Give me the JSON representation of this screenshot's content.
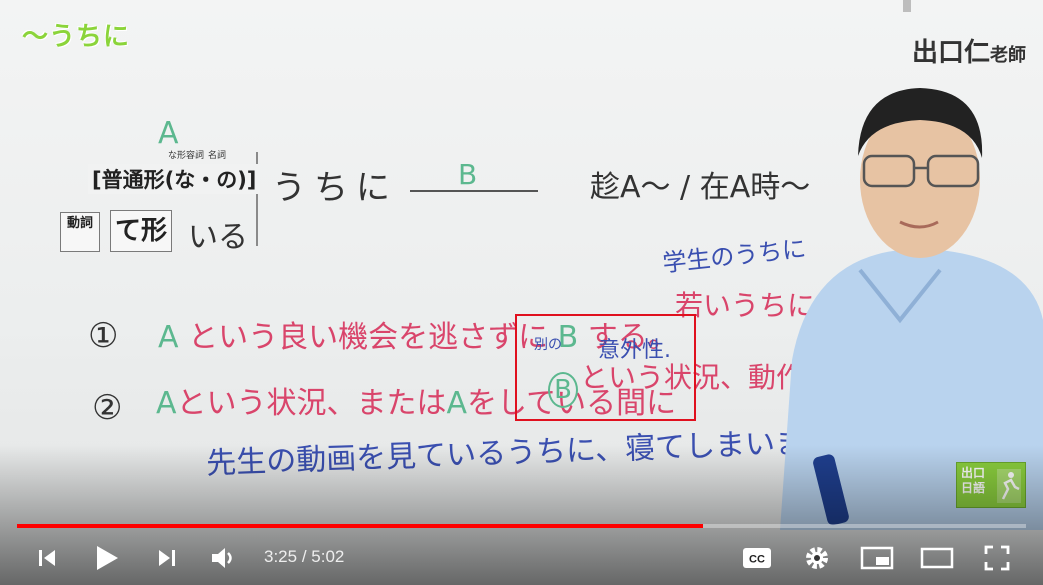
{
  "video": {
    "title": "〜うちに",
    "teacher_name": "出口仁",
    "teacher_suffix": "老師",
    "logo_text": "出口\n日語"
  },
  "board": {
    "label_a": "A",
    "na_adj_hint": "な形容詞",
    "noun_hint": "名詞",
    "form_bracket": "[普通形(な・の)]",
    "verb_tag": "動詞",
    "te_form": "て形",
    "iru": "いる",
    "uchini": "うちに",
    "blank_b": "B",
    "translation": "趁A〜 / 在A時〜",
    "example_student": "学生のうちに",
    "item1_num": "①",
    "item1_text_a": "A",
    "item1_text": "という良い機会を逃さずに",
    "item1_b": "B",
    "item1_end": "する。",
    "item1_young": "若いうちに",
    "item2_num": "②",
    "item2_a1": "A",
    "item2_text1": "という状況、または",
    "item2_a2": "A",
    "item2_text2": "をしている間に",
    "item2_b": "B",
    "item2_text3": "という状況、動作",
    "annotation_other": "別の",
    "annotation_unexpected": "意外性.",
    "example_sentence": "先生の動画を見ているうちに、寝てしまいま"
  },
  "player": {
    "current_time": "3:25",
    "separator": " / ",
    "duration": "5:02",
    "progress_fraction": 0.68,
    "progress_color": "#ff0000"
  },
  "colors": {
    "title_green": "#8bd43a",
    "marker_green": "#5cb88f",
    "marker_red": "#d9456b",
    "marker_blue": "#3a4fb0",
    "highlight": "#e0101e"
  },
  "icons": [
    "previous-icon",
    "play-icon",
    "next-icon",
    "volume-icon",
    "subtitles-icon",
    "settings-icon",
    "miniplayer-icon",
    "theater-icon",
    "fullscreen-icon"
  ]
}
